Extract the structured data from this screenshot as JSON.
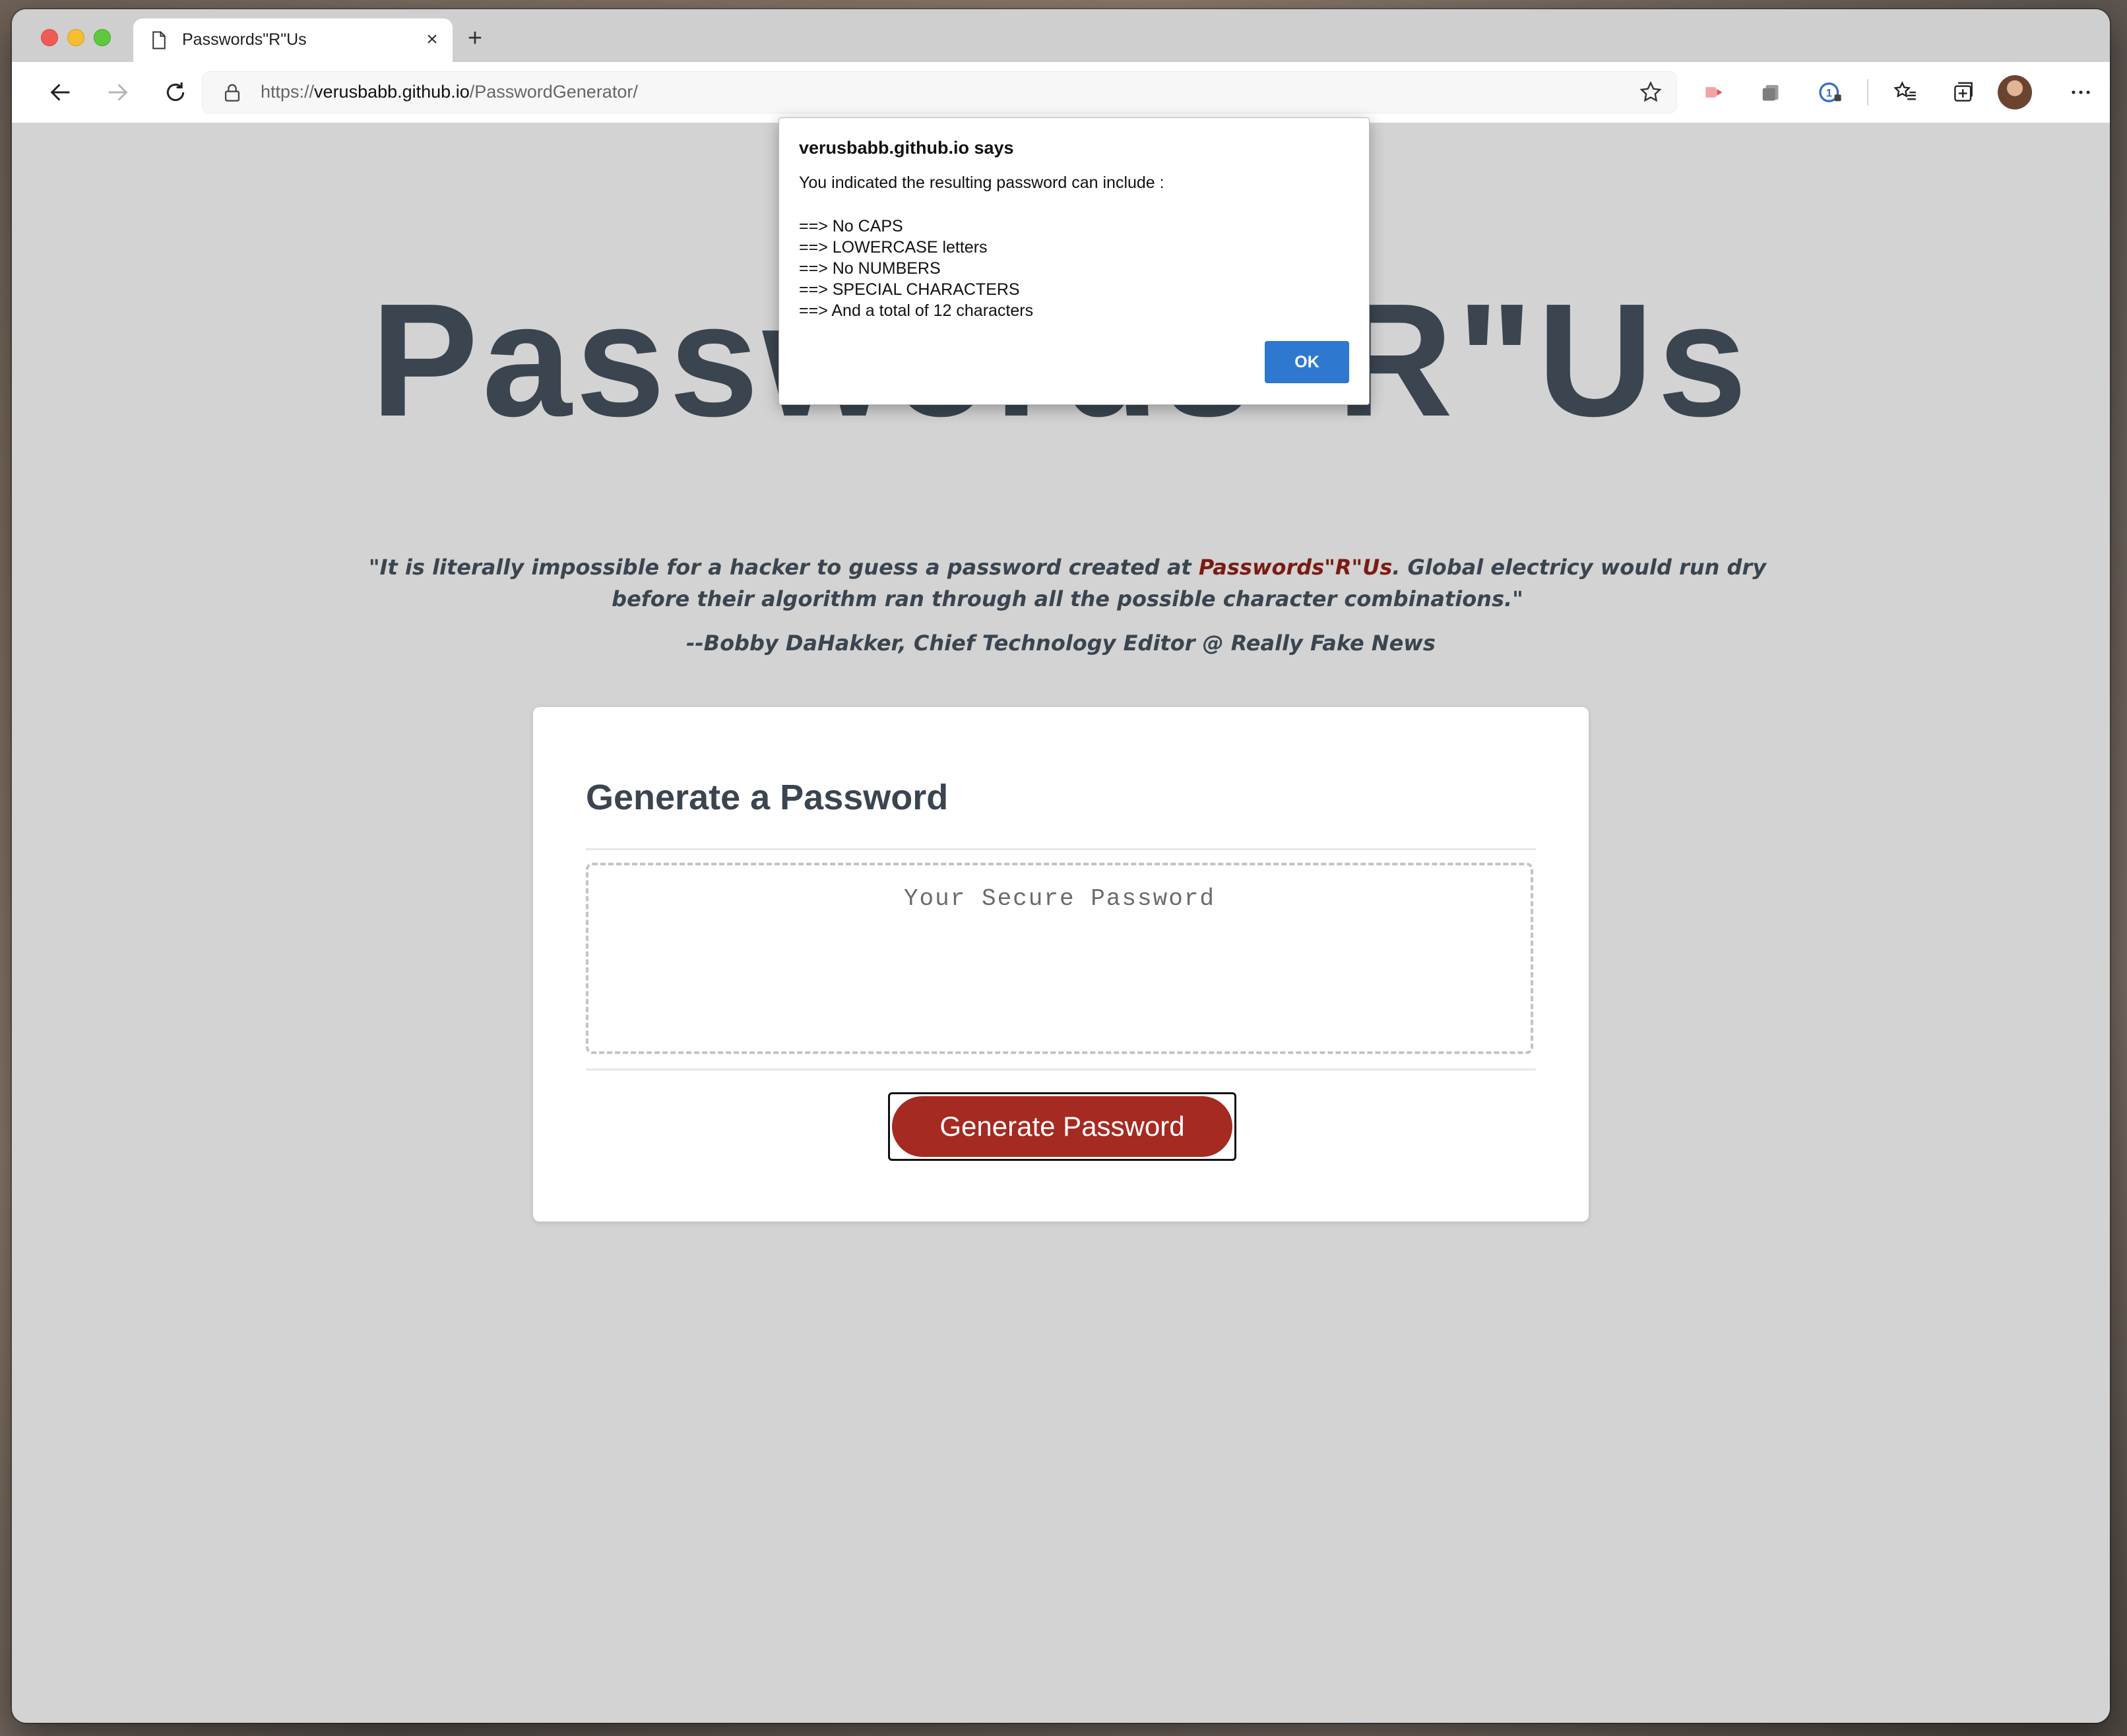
{
  "browser": {
    "tab_title": "Passwords\"R\"Us",
    "new_tab_symbol": "+",
    "close_symbol": "×",
    "url_scheme": "https://",
    "url_host": "verusbabb.github.io",
    "url_path": "/PasswordGenerator/"
  },
  "page": {
    "headline": "Passwords\"R\"Us",
    "quote_part1": "\"It is literally impossible for a hacker to guess a password created at ",
    "quote_brand": "Passwords\"R\"Us",
    "quote_part2": ". Global electricy would run dry before their algorithm ran through all the possible character combinations.\"",
    "attribution": "--Bobby DaHakker, Chief Technology Editor @ Really Fake News",
    "card_title": "Generate a Password",
    "password_placeholder": "Your Secure Password",
    "generate_button": "Generate Password"
  },
  "dialog": {
    "title": "verusbabb.github.io says",
    "intro": "You indicated the resulting password can include :",
    "lines": [
      "==> No CAPS",
      "==> LOWERCASE letters",
      "==> No NUMBERS",
      "==> SPECIAL CHARACTERS",
      "==> And a total of 12 characters"
    ],
    "ok_label": "OK"
  },
  "colors": {
    "heading": "#3a4550",
    "brand_red": "#7a1b14",
    "button_red": "#a52a22",
    "dialog_ok": "#2f78d0",
    "page_bg": "#d3d3d3"
  },
  "icons": [
    "page-icon",
    "back-icon",
    "forward-icon",
    "reload-icon",
    "lock-icon",
    "star-icon",
    "extension-share-icon",
    "collections-stack-icon",
    "password-lock-icon",
    "favorites-icon",
    "collections-icon",
    "profile-avatar",
    "more-menu-icon"
  ]
}
